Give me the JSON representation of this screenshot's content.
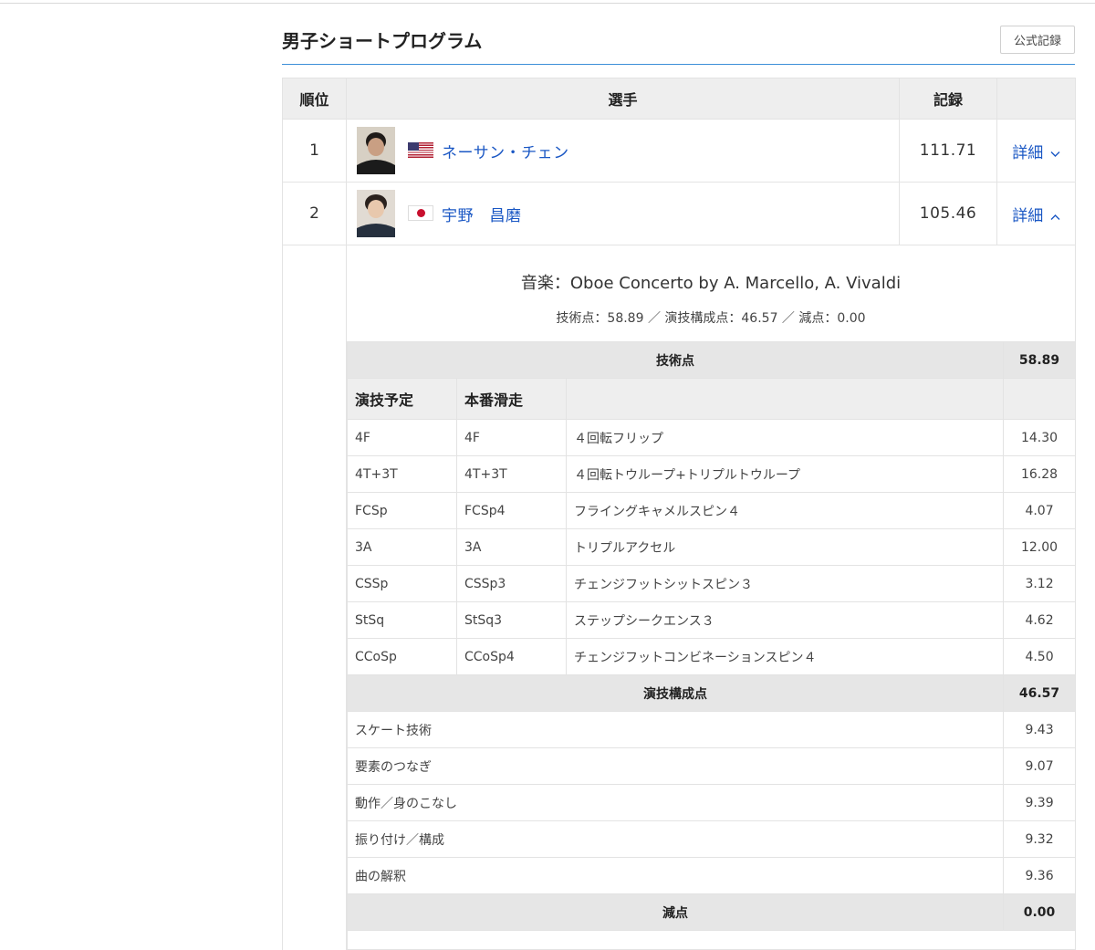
{
  "section": {
    "title": "男子ショートプログラム",
    "official_button": "公式記録"
  },
  "table": {
    "headers": {
      "rank": "順位",
      "athlete": "選手",
      "score": "記録"
    },
    "rows": [
      {
        "rank": "1",
        "name": "ネーサン・チェン",
        "flag": "us-flag-icon",
        "score": "111.71",
        "detail": "詳細",
        "toggle": "chevron-down-icon"
      },
      {
        "rank": "2",
        "name": "宇野　昌磨",
        "flag": "jp-flag-icon",
        "score": "105.46",
        "detail": "詳細",
        "toggle": "chevron-up-icon"
      }
    ]
  },
  "detail": {
    "music": "音楽：Oboe Concerto by A. Marcello, A. Vivaldi",
    "scores_line": "技術点：58.89 ／ 演技構成点：46.57 ／ 減点：0.00",
    "technical": {
      "label": "技術点",
      "total": "58.89",
      "col_planned": "演技予定",
      "col_executed": "本番滑走",
      "elements": [
        {
          "planned": "4F",
          "executed": "4F",
          "name": "４回転フリップ",
          "score": "14.30"
        },
        {
          "planned": "4T+3T",
          "executed": "4T+3T",
          "name": "４回転トウループ+トリプルトウループ",
          "score": "16.28"
        },
        {
          "planned": "FCSp",
          "executed": "FCSp4",
          "name": "フライングキャメルスピン４",
          "score": "4.07"
        },
        {
          "planned": "3A",
          "executed": "3A",
          "name": "トリプルアクセル",
          "score": "12.00"
        },
        {
          "planned": "CSSp",
          "executed": "CSSp3",
          "name": "チェンジフットシットスピン３",
          "score": "3.12"
        },
        {
          "planned": "StSq",
          "executed": "StSq3",
          "name": "ステップシークエンス３",
          "score": "4.62"
        },
        {
          "planned": "CCoSp",
          "executed": "CCoSp4",
          "name": "チェンジフットコンビネーションスピン４",
          "score": "4.50"
        }
      ]
    },
    "components": {
      "label": "演技構成点",
      "total": "46.57",
      "items": [
        {
          "name": "スケート技術",
          "score": "9.43"
        },
        {
          "name": "要素のつなぎ",
          "score": "9.07"
        },
        {
          "name": "動作／身のこなし",
          "score": "9.39"
        },
        {
          "name": "振り付け／構成",
          "score": "9.32"
        },
        {
          "name": "曲の解釈",
          "score": "9.36"
        }
      ]
    },
    "deductions": {
      "label": "減点",
      "total": "0.00"
    }
  }
}
